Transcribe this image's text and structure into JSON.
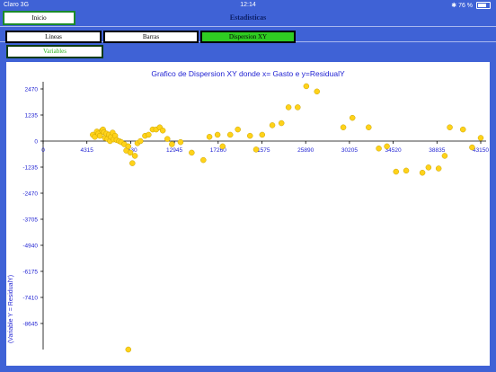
{
  "status_bar": {
    "carrier": "Claro 3G",
    "time": "12:14",
    "battery_label": "76 %",
    "battery_level": 0.76
  },
  "nav": {
    "home_label": "Inicio",
    "title": "Estadisticas"
  },
  "tabs": [
    {
      "label": "Lineas",
      "active": false
    },
    {
      "label": "Barras",
      "active": false
    },
    {
      "label": "Dispersion XY",
      "active": true
    }
  ],
  "variables_button": "Variables",
  "colors": {
    "background": "#3f62d6",
    "active_tab": "#2fcc22",
    "point": "#ffd21a",
    "text_blue": "#1d1fd2"
  },
  "chart_data": {
    "type": "scatter",
    "title": "Grafico de Dispersion XY donde x= Gasto e y=ResidualY",
    "ylabel": "(Variable Y = ResidualY)",
    "xlabel": "",
    "x_ticks": [
      "0",
      "4315",
      "8630",
      "12945",
      "17260",
      "21575",
      "25890",
      "30205",
      "34520",
      "38835",
      "43150"
    ],
    "y_ticks": [
      "2470",
      "1235",
      "0",
      "-1235",
      "-2470",
      "-3705",
      "-4940",
      "-6175",
      "-7410",
      "-8645"
    ],
    "xlim": [
      0,
      43150
    ],
    "ylim": [
      -9880,
      2900
    ],
    "grid": false,
    "points": [
      [
        4900,
        300
      ],
      [
        5100,
        200
      ],
      [
        5300,
        450
      ],
      [
        5450,
        350
      ],
      [
        5600,
        250
      ],
      [
        5800,
        500
      ],
      [
        5900,
        550
      ],
      [
        6000,
        420
      ],
      [
        6100,
        150
      ],
      [
        6250,
        350
      ],
      [
        6350,
        100
      ],
      [
        6500,
        300
      ],
      [
        6600,
        0
      ],
      [
        6700,
        200
      ],
      [
        6850,
        400
      ],
      [
        6950,
        80
      ],
      [
        7100,
        250
      ],
      [
        7250,
        50
      ],
      [
        7500,
        0
      ],
      [
        7700,
        -50
      ],
      [
        8000,
        -150
      ],
      [
        8200,
        -450
      ],
      [
        8400,
        -250
      ],
      [
        8600,
        -550
      ],
      [
        8800,
        -1050
      ],
      [
        9050,
        -700
      ],
      [
        9300,
        -100
      ],
      [
        9600,
        0
      ],
      [
        10050,
        250
      ],
      [
        10400,
        300
      ],
      [
        10800,
        550
      ],
      [
        11150,
        550
      ],
      [
        11500,
        650
      ],
      [
        11800,
        500
      ],
      [
        12250,
        100
      ],
      [
        12700,
        -150
      ],
      [
        13550,
        -50
      ],
      [
        14650,
        -550
      ],
      [
        15800,
        -900
      ],
      [
        16400,
        200
      ],
      [
        17200,
        300
      ],
      [
        17700,
        -250
      ],
      [
        18450,
        300
      ],
      [
        19200,
        550
      ],
      [
        20400,
        250
      ],
      [
        21000,
        -400
      ],
      [
        21600,
        300
      ],
      [
        22600,
        750
      ],
      [
        23500,
        850
      ],
      [
        24200,
        1600
      ],
      [
        25100,
        1600
      ],
      [
        25950,
        2600
      ],
      [
        27000,
        2350
      ],
      [
        29600,
        650
      ],
      [
        30500,
        1100
      ],
      [
        32100,
        650
      ],
      [
        33100,
        -350
      ],
      [
        33900,
        -250
      ],
      [
        34800,
        -1450
      ],
      [
        35800,
        -1400
      ],
      [
        37400,
        -1500
      ],
      [
        38000,
        -1250
      ],
      [
        39000,
        -1300
      ],
      [
        39600,
        -700
      ],
      [
        40100,
        650
      ],
      [
        41400,
        550
      ],
      [
        42300,
        -300
      ],
      [
        43150,
        150
      ],
      [
        8400,
        -9880
      ]
    ]
  }
}
